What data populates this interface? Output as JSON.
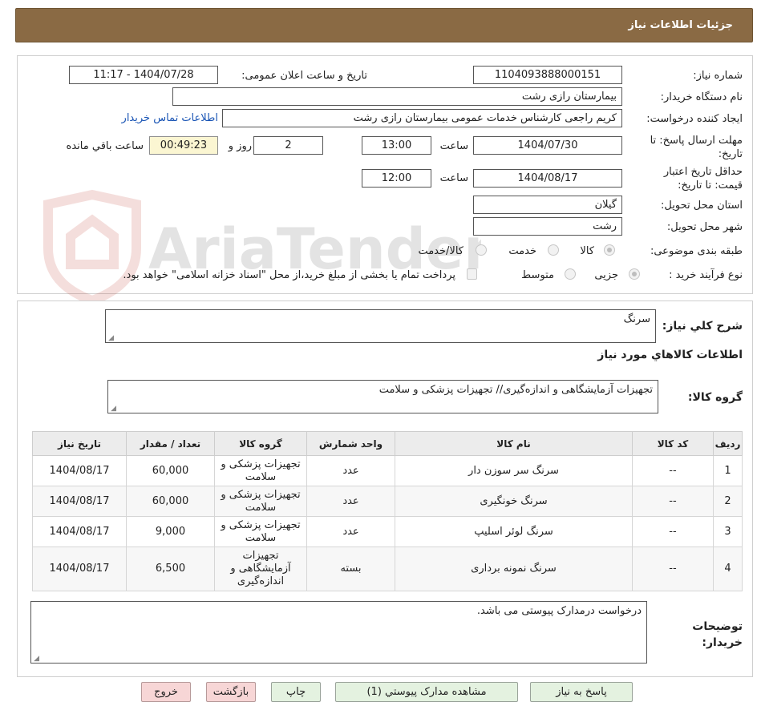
{
  "header": {
    "title": "جزئیات اطلاعات نیاز"
  },
  "watermark": {
    "text": "AriaTender.neT"
  },
  "fields": {
    "need_number": {
      "label": "شماره نیاز:",
      "value": "1104093888000151"
    },
    "announce_datetime": {
      "label": "تاریخ و ساعت اعلان عمومی:",
      "value": "1404/07/28 - 11:17"
    },
    "buyer_org": {
      "label": "نام دستگاه خریدار:",
      "value": "بیمارستان رازی رشت"
    },
    "requester": {
      "label": "ایجاد کننده درخواست:",
      "value": "کریم راجعی کارشناس خدمات عمومی بیمارستان رازی رشت",
      "contact_link": "اطلاعات تماس خریدار"
    },
    "reply_deadline": {
      "label": "مهلت ارسال پاسخ: تا تاریخ:",
      "date": "1404/07/30",
      "time_label": "ساعت",
      "time": "13:00",
      "days": "2",
      "days_label": "روز و",
      "remaining": "00:49:23",
      "remaining_label": "ساعت باقي مانده"
    },
    "price_validity": {
      "label": "حداقل تاریخ اعتبار قیمت: تا تاریخ:",
      "date": "1404/08/17",
      "time_label": "ساعت",
      "time": "12:00"
    },
    "province": {
      "label": "استان محل تحویل:",
      "value": "گیلان"
    },
    "city": {
      "label": "شهر محل تحویل:",
      "value": "رشت"
    },
    "category": {
      "label": "طبقه بندی موضوعی:",
      "options": [
        "کالا",
        "خدمت",
        "کالا/خدمت"
      ]
    },
    "process_type": {
      "label": "نوع فرآیند خرید :",
      "options": [
        "جزیی",
        "متوسط"
      ],
      "treasury_note": "پرداخت تمام یا بخشی از مبلغ خرید،از محل \"اسناد خزانه اسلامی\" خواهد بود."
    }
  },
  "summary": {
    "label": "شرح كلي نياز:",
    "value": "سرنگ"
  },
  "goods_info_title": "اطلاعات كالاهاي مورد نياز",
  "goods_group": {
    "label": "گروه کالا:",
    "value": "تجهیزات آزمایشگاهی و اندازه‌گیری// تجهیزات پزشکی و سلامت"
  },
  "table": {
    "headers": [
      "ردیف",
      "کد کالا",
      "نام کالا",
      "واحد شمارش",
      "گروه کالا",
      "تعداد / مقدار",
      "تاریخ نیاز"
    ],
    "rows": [
      {
        "row": "1",
        "code": "--",
        "name": "سرنگ سر سوزن دار",
        "unit": "عدد",
        "group": "تجهیزات پزشکی و سلامت",
        "qty": "60,000",
        "date": "1404/08/17"
      },
      {
        "row": "2",
        "code": "--",
        "name": "سرنگ خونگیری",
        "unit": "عدد",
        "group": "تجهیزات پزشکی و سلامت",
        "qty": "60,000",
        "date": "1404/08/17"
      },
      {
        "row": "3",
        "code": "--",
        "name": "سرنگ لوئر اسلیپ",
        "unit": "عدد",
        "group": "تجهیزات پزشکی و سلامت",
        "qty": "9,000",
        "date": "1404/08/17"
      },
      {
        "row": "4",
        "code": "--",
        "name": "سرنگ نمونه برداری",
        "unit": "بسته",
        "group": "تجهیزات آزمایشگاهی و اندازه‌گیری",
        "qty": "6,500",
        "date": "1404/08/17"
      }
    ]
  },
  "buyer_notes": {
    "label": "توضیحات خریدار:",
    "value": "درخواست درمدارک پیوستی می باشد."
  },
  "buttons": {
    "reply": "پاسخ به نیاز",
    "attachments": "مشاهده مدارک پیوستي (1)",
    "print": "چاپ",
    "back": "بازگشت",
    "exit": "خروج"
  }
}
